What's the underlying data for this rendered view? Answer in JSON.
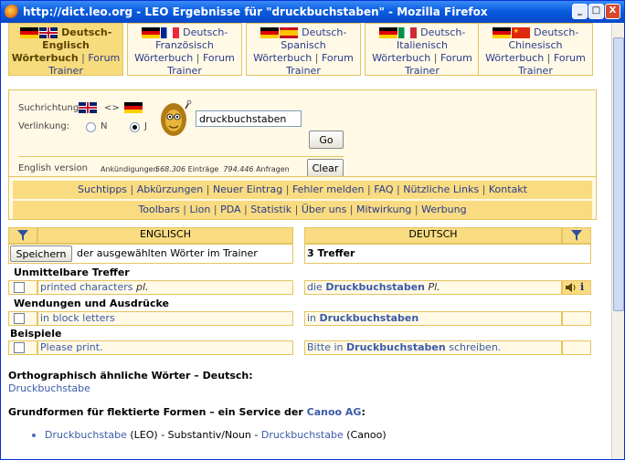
{
  "window": {
    "title": "http://dict.leo.org - LEO Ergebnisse für \"druckbuchstaben\" - Mozilla Firefox",
    "minimize": "_",
    "maximize": "□",
    "close": "X"
  },
  "tabs": [
    {
      "title1": "Deutsch-",
      "title2": "Englisch",
      "title3": "Wörterbuch",
      "forum": "Forum",
      "trainer": "Trainer",
      "active": true
    },
    {
      "title1": "Deutsch-",
      "title2": "Französisch",
      "title3": "Wörterbuch",
      "forum": "Forum",
      "trainer": "Trainer"
    },
    {
      "title1": "Deutsch-",
      "title2": "Spanisch",
      "title3": "Wörterbuch",
      "forum": "Forum",
      "trainer": "Trainer"
    },
    {
      "title1": "Deutsch-",
      "title2": "Italienisch",
      "title3": "Wörterbuch",
      "forum": "Forum",
      "trainer": "Trainer"
    },
    {
      "title1": "Deutsch-",
      "title2": "Chinesisch",
      "title3": "Wörterbuch",
      "forum": "Forum",
      "trainer": "Trainer"
    }
  ],
  "search": {
    "direction_label": "Suchrichtung:",
    "direction_arrow": "<>",
    "linking_label": "Verlinkung:",
    "radio_n": "N",
    "radio_j": "J",
    "query": "druckbuchstaben",
    "go": "Go",
    "clear": "Clear",
    "english_version": "English version",
    "announcements": "Ankündigungen",
    "entries_count": "568.306",
    "entries_label": "Einträge",
    "queries_count": "794.446",
    "queries_label": "Anfragen"
  },
  "nav": {
    "row1": [
      "Suchtipps",
      "Abkürzungen",
      "Neuer Eintrag",
      "Fehler melden",
      "FAQ",
      "Nützliche Links",
      "Kontakt"
    ],
    "row2": [
      "Toolbars",
      "Lion",
      "PDA",
      "Statistik",
      "Über uns",
      "Mitwirkung",
      "Werbung"
    ]
  },
  "results": {
    "col_en": "ENGLISCH",
    "col_de": "DEUTSCH",
    "save_button": "Speichern",
    "save_text": "der ausgewählten Wörter im Trainer",
    "hits": "3 Treffer",
    "section1": "Unmittelbare Treffer",
    "r1_en": "printed characters",
    "r1_en_pl": "pl.",
    "r1_de_pre": "die",
    "r1_de_word": "Druckbuchstaben",
    "r1_de_pl": "Pl.",
    "section2": "Wendungen und Ausdrücke",
    "r2_en": "in block letters",
    "r2_de_pre": "in",
    "r2_de_word": "Druckbuchstaben",
    "section3": "Beispiele",
    "r3_en": "Please print.",
    "r3_de_pre": "Bitte in",
    "r3_de_word": "Druckbuchstaben",
    "r3_de_post": "schreiben.",
    "info_icon": "i"
  },
  "bottom": {
    "ortho_heading": "Orthographisch ähnliche Wörter – Deutsch:",
    "ortho_word": "Druckbuchstabe",
    "base_heading_pre": "Grundformen für flektierte Formen – ein Service der",
    "base_heading_link": "Canoo AG",
    "base_heading_post": ":",
    "item_word1": "Druckbuchstabe",
    "item_leo": "(LEO)",
    "item_mid": "- Substantiv/Noun -",
    "item_word2": "Druckbuchstabe",
    "item_canoo": "(Canoo)"
  },
  "colors": {
    "accent_panel": "#fff9e6",
    "accent_header": "#f9dc82",
    "border": "#e5c460",
    "link": "#293a8b"
  }
}
